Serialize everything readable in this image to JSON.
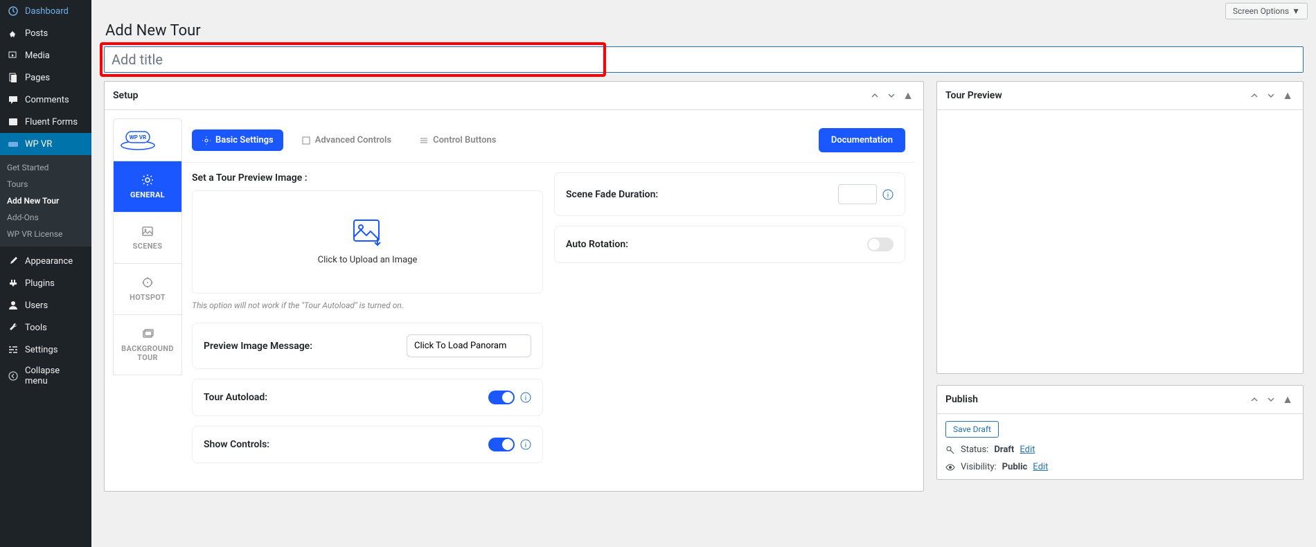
{
  "topbar": {
    "screen_options": "Screen Options"
  },
  "sidebar": {
    "items": [
      {
        "label": "Dashboard"
      },
      {
        "label": "Posts"
      },
      {
        "label": "Media"
      },
      {
        "label": "Pages"
      },
      {
        "label": "Comments"
      },
      {
        "label": "Fluent Forms"
      },
      {
        "label": "WP VR"
      }
    ],
    "submenu": [
      {
        "label": "Get Started"
      },
      {
        "label": "Tours"
      },
      {
        "label": "Add New Tour"
      },
      {
        "label": "Add-Ons"
      },
      {
        "label": "WP VR License"
      }
    ],
    "items2": [
      {
        "label": "Appearance"
      },
      {
        "label": "Plugins"
      },
      {
        "label": "Users"
      },
      {
        "label": "Tools"
      },
      {
        "label": "Settings"
      },
      {
        "label": "Collapse menu"
      }
    ]
  },
  "page": {
    "heading": "Add New Tour",
    "title_placeholder": "Add title"
  },
  "setup": {
    "title": "Setup",
    "brand_text": "WP VR",
    "vtabs": {
      "general": "GENERAL",
      "scenes": "SCENES",
      "hotspot": "HOTSPOT",
      "bgtour": "BACKGROUND TOUR"
    },
    "pills": {
      "basic": "Basic Settings",
      "advanced": "Advanced Controls",
      "control": "Control Buttons"
    },
    "doc_btn": "Documentation",
    "left": {
      "preview_label": "Set a Tour Preview Image :",
      "upload_text": "Click to Upload an Image",
      "helper": "This option will not work if the \"Tour Autoload\" is turned on.",
      "preview_msg_label": "Preview Image Message:",
      "preview_msg_value": "Click To Load Panoram",
      "autoload_label": "Tour Autoload:",
      "controls_label": "Show Controls:"
    },
    "right": {
      "fade_label": "Scene Fade Duration:",
      "autorotation_label": "Auto Rotation:"
    }
  },
  "preview_box": {
    "title": "Tour Preview"
  },
  "publish": {
    "title": "Publish",
    "save_draft": "Save Draft",
    "status_label": "Status:",
    "status_value": "Draft",
    "visibility_label": "Visibility:",
    "visibility_value": "Public",
    "edit": "Edit"
  }
}
